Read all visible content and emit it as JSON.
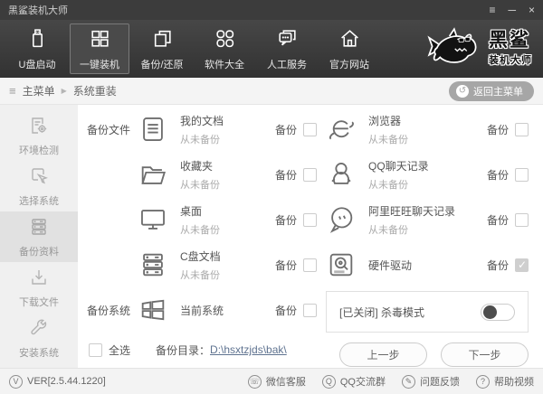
{
  "window": {
    "title": "黑鲨装机大师",
    "controls": {
      "menu": "≡",
      "minimize": "─",
      "close": "×"
    }
  },
  "glyphs": {
    "breadcrumb_menu": "≡",
    "breadcrumb_arrow": "▶",
    "back_arrow": "↺"
  },
  "nav": {
    "items": [
      {
        "label": "U盘启动",
        "icon": "usb-drive-icon",
        "active": false
      },
      {
        "label": "一键装机",
        "icon": "one-key-install-icon",
        "active": true
      },
      {
        "label": "备份/还原",
        "icon": "backup-restore-icon",
        "active": false
      },
      {
        "label": "软件大全",
        "icon": "software-collection-icon",
        "active": false
      },
      {
        "label": "人工服务",
        "icon": "live-support-icon",
        "active": false
      },
      {
        "label": "官方网站",
        "icon": "official-website-icon",
        "active": false
      }
    ],
    "brand": {
      "line1": "黑鲨",
      "line2": "装机大师"
    }
  },
  "breadcrumb": {
    "root": "主菜单",
    "current": "系统重装",
    "back_button": "返回主菜单"
  },
  "sidebar": {
    "items": [
      {
        "label": "环境检测",
        "icon": "environment-check-icon",
        "active": false
      },
      {
        "label": "选择系统",
        "icon": "select-system-icon",
        "active": false
      },
      {
        "label": "备份资料",
        "icon": "backup-data-icon",
        "active": true
      },
      {
        "label": "下载文件",
        "icon": "download-files-icon",
        "active": false
      },
      {
        "label": "安装系统",
        "icon": "install-system-icon",
        "active": false
      }
    ]
  },
  "main": {
    "backup_checkbox_label": "备份",
    "sections": {
      "files": "备份文件",
      "system": "备份系统"
    },
    "left_rows": [
      {
        "title": "我的文档",
        "subtitle": "从未备份",
        "checked": false,
        "icon": "my-documents-icon"
      },
      {
        "title": "收藏夹",
        "subtitle": "从未备份",
        "checked": false,
        "icon": "favorites-folder-icon"
      },
      {
        "title": "桌面",
        "subtitle": "从未备份",
        "checked": false,
        "icon": "desktop-icon"
      },
      {
        "title": "C盘文档",
        "subtitle": "从未备份",
        "checked": false,
        "icon": "c-drive-docs-icon"
      },
      {
        "title": "当前系统",
        "subtitle": "",
        "checked": false,
        "icon": "current-system-icon"
      }
    ],
    "right_rows": [
      {
        "title": "浏览器",
        "subtitle": "从未备份",
        "checked": false,
        "icon": "browser-icon"
      },
      {
        "title": "QQ聊天记录",
        "subtitle": "从未备份",
        "checked": false,
        "icon": "qq-chat-icon"
      },
      {
        "title": "阿里旺旺聊天记录",
        "subtitle": "从未备份",
        "checked": false,
        "icon": "aliwangwang-chat-icon"
      },
      {
        "title": "硬件驱动",
        "subtitle": "",
        "checked": true,
        "icon": "hardware-driver-icon"
      }
    ],
    "antivirus": {
      "label": "[已关闭] 杀毒模式",
      "enabled": false
    },
    "select_all_label": "全选",
    "backup_dir_label": "备份目录：",
    "backup_dir_path": "D:\\hsxtzjds\\bak\\",
    "prev_button": "上一步",
    "next_button": "下一步"
  },
  "statusbar": {
    "version": "VER[2.5.44.1220]",
    "version_glyph": "V",
    "links": [
      {
        "label": "微信客服",
        "glyph": "☏",
        "icon": "wechat-service-icon"
      },
      {
        "label": "QQ交流群",
        "glyph": "Q",
        "icon": "qq-group-icon"
      },
      {
        "label": "问题反馈",
        "glyph": "✎",
        "icon": "feedback-icon"
      },
      {
        "label": "帮助视频",
        "glyph": "?",
        "icon": "help-video-icon"
      }
    ]
  }
}
